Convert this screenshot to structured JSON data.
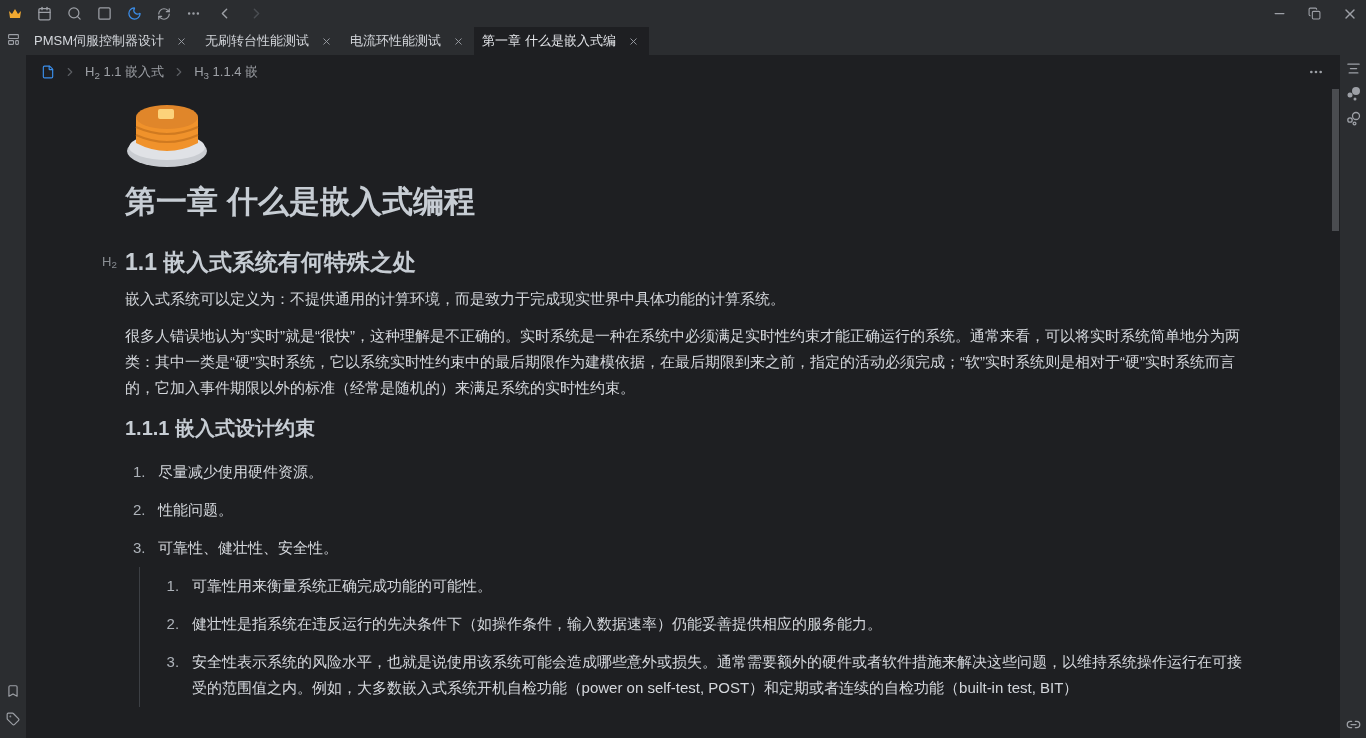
{
  "tabs": [
    {
      "label": "PMSM伺服控制器设计",
      "selected": false
    },
    {
      "label": "无刷转台性能测试",
      "selected": false
    },
    {
      "label": "电流环性能测试",
      "selected": false
    },
    {
      "label": "第一章 什么是嵌入式编",
      "selected": true
    }
  ],
  "breadcrumb": [
    {
      "mark": "H$_{2}$",
      "label": "1.1 嵌入式"
    },
    {
      "mark": "H$_{3}$",
      "label": "1.1.4 嵌"
    }
  ],
  "document": {
    "title": "第一章 什么是嵌入式编程",
    "section": {
      "mark": "H$_{2}$",
      "heading": "1.1 嵌入式系统有何特殊之处"
    },
    "paragraphs": [
      "嵌入式系统可以定义为：不提供通用的计算环境，而是致力于完成现实世界中具体功能的计算系统。",
      "很多人错误地认为“实时”就是“很快”，这种理解是不正确的。实时系统是一种在系统中必须满足实时性约束才能正确运行的系统。通常来看，可以将实时系统简单地分为两类：其中一类是“硬”实时系统，它以系统实时性约束中的最后期限作为建模依据，在最后期限到来之前，指定的活动必须完成；“软”实时系统则是相对于“硬”实时系统而言的，它加入事件期限以外的标准（经常是随机的）来满足系统的实时性约束。"
    ],
    "subheading": "1.1.1 嵌入式设计约束",
    "list": [
      {
        "number": "1.",
        "text": "尽量减少使用硬件资源。"
      },
      {
        "number": "2.",
        "text": "性能问题。"
      },
      {
        "number": "3.",
        "text": "可靠性、健壮性、安全性。",
        "children": [
          {
            "number": "1.",
            "text": "可靠性用来衡量系统正确完成功能的可能性。"
          },
          {
            "number": "2.",
            "text": "健壮性是指系统在违反运行的先决条件下（如操作条件，输入数据速率）仍能妥善提供相应的服务能力。"
          },
          {
            "number": "3.",
            "text": "安全性表示系统的风险水平，也就是说使用该系统可能会造成哪些意外或损失。通常需要额外的硬件或者软件措施来解决这些问题，以维持系统操作运行在可接受的范围值之内。例如，大多数嵌入式系统开机自检功能（power on self-test, POST）和定期或者连续的自检功能（built-in test, BIT）"
          }
        ]
      }
    ]
  }
}
